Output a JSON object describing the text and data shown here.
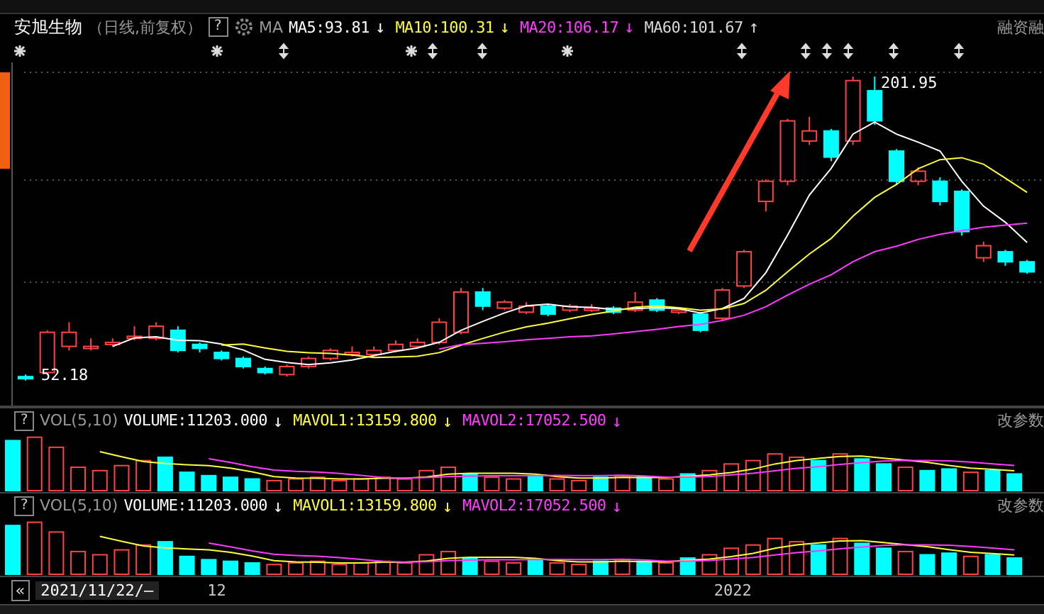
{
  "title_bar": {
    "stock_name": "安旭生物",
    "period": "（日线,前复权）",
    "help": "?",
    "indicator": "MA",
    "ma_values": [
      {
        "label": "MA5:93.81",
        "arrow": "↓",
        "color": "#ffffff"
      },
      {
        "label": "MA10:100.31",
        "arrow": "↓",
        "color": "#ffff3c"
      },
      {
        "label": "MA20:106.17",
        "arrow": "↓",
        "color": "#ff3cff"
      },
      {
        "label": "MA60:101.67",
        "arrow": "↑",
        "color": "#d8d8d8"
      }
    ],
    "right_label": "融资融"
  },
  "price_chart": {
    "high_label": "201.95",
    "low_label": "52.18"
  },
  "volume_panels": [
    {
      "help": "?",
      "name": "VOL(5,10)",
      "values": [
        {
          "label": "VOLUME:11203.000",
          "arrow": "↓",
          "color": "#ffffff"
        },
        {
          "label": "MAVOL1:13159.800",
          "arrow": "↓",
          "color": "#ffff3c"
        },
        {
          "label": "MAVOL2:17052.500",
          "arrow": "↓",
          "color": "#ff3cff"
        }
      ],
      "settings": "改参数"
    },
    {
      "help": "?",
      "name": "VOL(5,10)",
      "values": [
        {
          "label": "VOLUME:11203.000",
          "arrow": "↓",
          "color": "#ffffff"
        },
        {
          "label": "MAVOL1:13159.800",
          "arrow": "↓",
          "color": "#ffff3c"
        },
        {
          "label": "MAVOL2:17052.500",
          "arrow": "↓",
          "color": "#ff3cff"
        }
      ],
      "settings": "改参数"
    }
  ],
  "date_bar": {
    "back": "«",
    "date": "2021/11/22/—",
    "labels": [
      "12",
      "2022"
    ]
  }
}
